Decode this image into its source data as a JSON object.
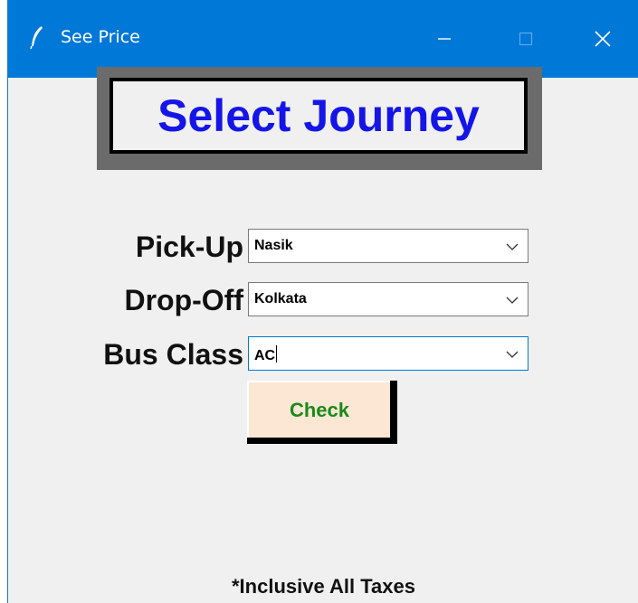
{
  "window": {
    "title": "See Price",
    "controls": {
      "minimize": "minimize",
      "maximize": "maximize",
      "close": "close"
    }
  },
  "header": {
    "title": "Select Journey"
  },
  "form": {
    "pickup": {
      "label": "Pick-Up",
      "value": "Nasik"
    },
    "dropoff": {
      "label": "Drop-Off",
      "value": "Kolkata"
    },
    "bus_class": {
      "label": "Bus Class",
      "value": "AC"
    }
  },
  "check_button": {
    "label": "Check"
  },
  "footnote": "*Inclusive All Taxes",
  "colors": {
    "titlebar": "#0078d7",
    "header_text": "#1515e8",
    "check_text": "#1a8a1a",
    "check_bg": "#fbe7d4"
  }
}
